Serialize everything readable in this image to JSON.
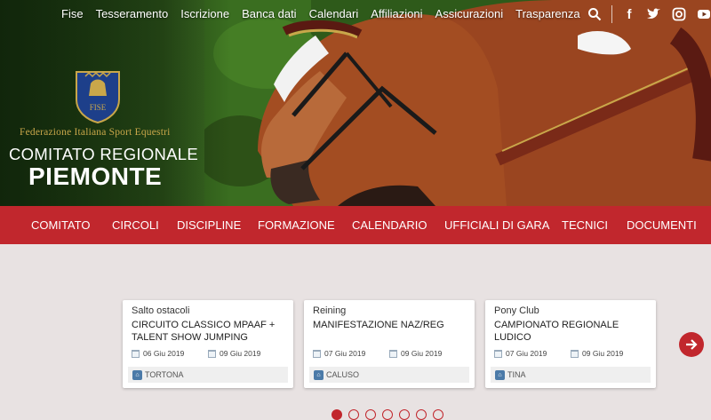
{
  "top_nav": [
    "Fise",
    "Tesseramento",
    "Iscrizione",
    "Banca dati",
    "Calendari",
    "Affiliazioni",
    "Assicurazioni",
    "Trasparenza"
  ],
  "top_icons": [
    "search-icon",
    "facebook-icon",
    "twitter-icon",
    "instagram-icon",
    "youtube-icon"
  ],
  "brand": {
    "logo_text": "FISE",
    "federation": "Federazione Italiana Sport Equestri",
    "comitato": "COMITATO REGIONALE",
    "region": "PIEMONTE"
  },
  "main_menu": [
    "COMITATO",
    "CIRCOLI",
    "DISCIPLINE",
    "FORMAZIONE",
    "CALENDARIO",
    "UFFICIALI DI GARA",
    "TECNICI",
    "DOCUMENTI"
  ],
  "cards": [
    {
      "category": "Salto ostacoli",
      "title": "CIRCUITO CLASSICO MPAAF + TALENT SHOW JUMPING",
      "start": "06 Giu 2019",
      "end": "09 Giu 2019",
      "place": "TORTONA"
    },
    {
      "category": "Reining",
      "title": "MANIFESTAZIONE NAZ/REG",
      "start": "07 Giu 2019",
      "end": "09 Giu 2019",
      "place": "CALUSO"
    },
    {
      "category": "Pony Club",
      "title": "CAMPIONATO REGIONALE LUDICO",
      "start": "07 Giu 2019",
      "end": "09 Giu 2019",
      "place": "TINA"
    }
  ],
  "pager": {
    "count": 7,
    "active": 0
  },
  "colors": {
    "accent": "#c1272d",
    "gold": "#c9a74a"
  }
}
